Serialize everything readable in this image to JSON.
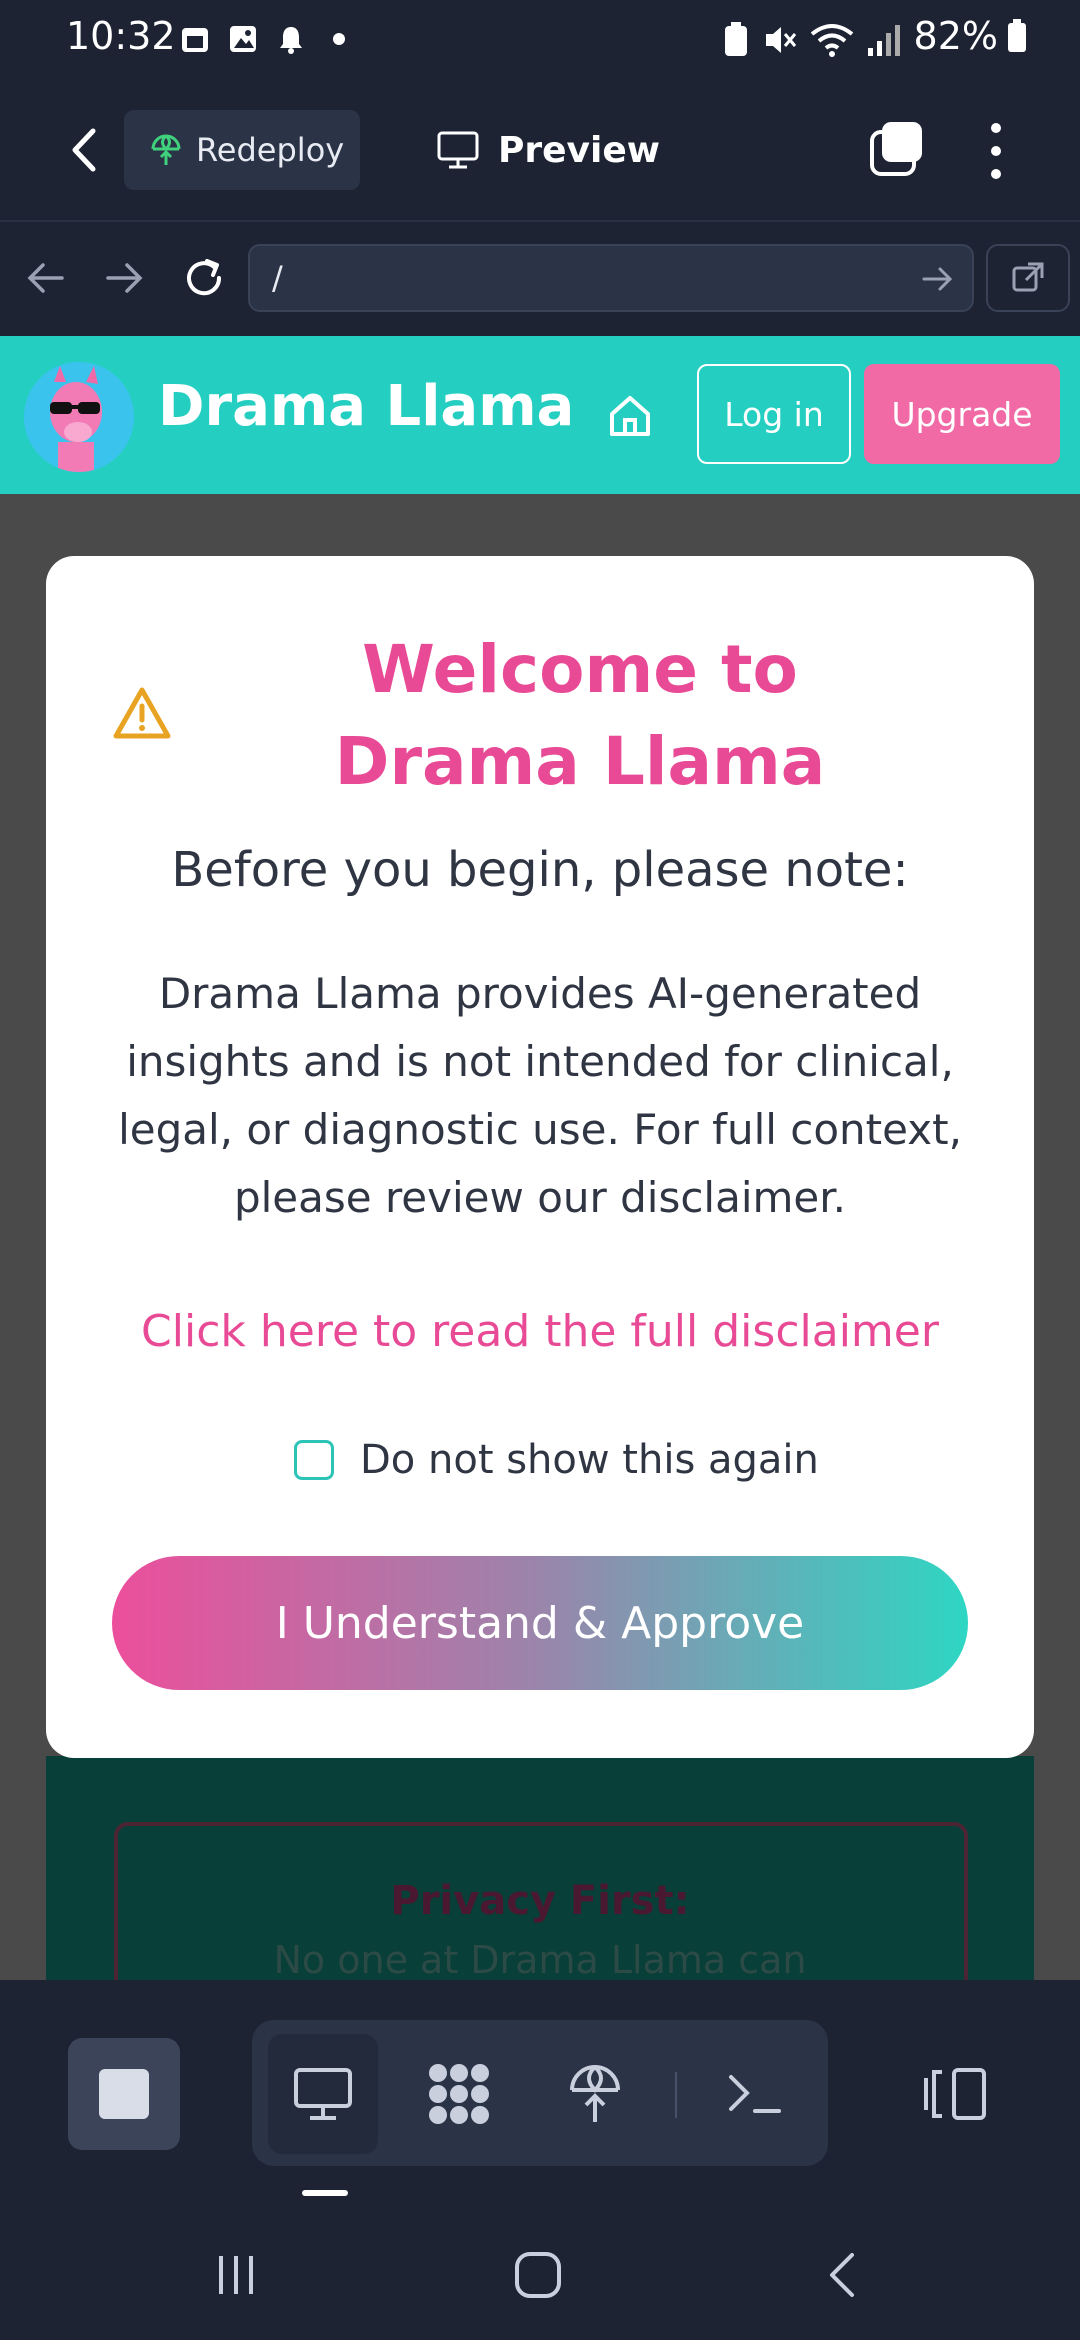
{
  "status_bar": {
    "time": "10:32",
    "battery": "82%"
  },
  "toolbar": {
    "redeploy_label": "Redeploy",
    "preview_label": "Preview"
  },
  "url_bar": {
    "value": "/"
  },
  "app_header": {
    "brand": "Drama Llama",
    "login_label": "Log in",
    "upgrade_label": "Upgrade"
  },
  "modal": {
    "title": "Welcome to Drama Llama",
    "subtitle": "Before you begin, please note:",
    "body": "Drama Llama provides AI-generated insights and is not intended for clinical, legal, or diagnostic use. For full context, please review our disclaimer.",
    "disclaimer_link": "Click here to read the full disclaimer",
    "checkbox_label": "Do not show this again",
    "checkbox_checked": false,
    "approve_label": "I Understand & Approve"
  },
  "background_card": {
    "title": "Privacy First:",
    "text": "No one at Drama Llama can"
  },
  "colors": {
    "header_teal": "#24cfc1",
    "accent_pink": "#e84a95",
    "upgrade_pink": "#f26aa5",
    "ide_dark": "#1d2333"
  }
}
